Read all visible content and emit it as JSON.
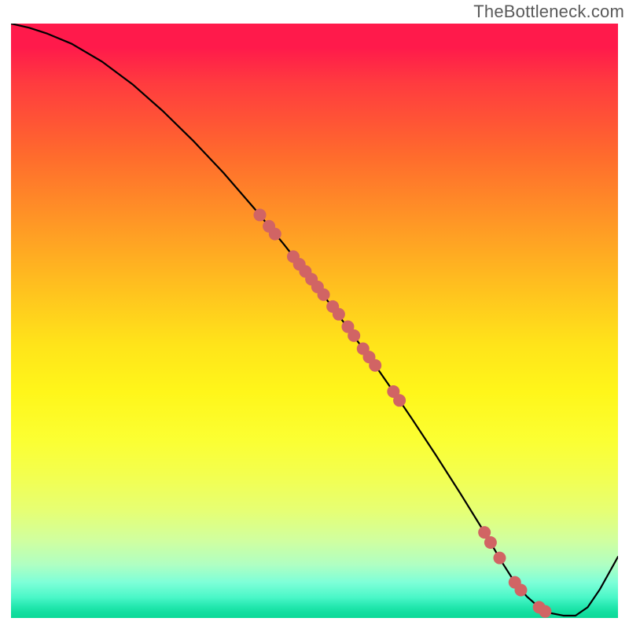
{
  "watermark": "TheBottleneck.com",
  "colors": {
    "curve": "#000000",
    "marker": "#d16464",
    "gradient_top": "#ff1a4b",
    "gradient_bottom": "#0bd997"
  },
  "chart_data": {
    "type": "line",
    "title": "",
    "xlabel": "",
    "ylabel": "",
    "xlim": [
      0,
      100
    ],
    "ylim": [
      0,
      100
    ],
    "curve": {
      "x": [
        0,
        3,
        6,
        10,
        15,
        20,
        25,
        30,
        35,
        40,
        45,
        50,
        55,
        60,
        63,
        66,
        70,
        74,
        78,
        81,
        83,
        85,
        87,
        89,
        91,
        93,
        95,
        97,
        100
      ],
      "y": [
        100,
        99.3,
        98.3,
        96.6,
        93.6,
        89.8,
        85.3,
        80.3,
        74.9,
        69.0,
        62.8,
        56.3,
        49.5,
        42.5,
        38.1,
        33.6,
        27.4,
        21.0,
        14.4,
        9.2,
        6.0,
        3.6,
        1.8,
        0.8,
        0.4,
        0.4,
        1.8,
        4.8,
        10.3
      ]
    },
    "markers": {
      "x": [
        41.0,
        42.5,
        43.5,
        46.5,
        47.5,
        48.5,
        49.5,
        50.5,
        51.5,
        53.0,
        54.0,
        55.5,
        56.5,
        58.0,
        59.0,
        60.0,
        63.0,
        64.0,
        78.0,
        79.0,
        80.5,
        83.0,
        84.0,
        87.0,
        88.0
      ],
      "y": [
        67.8,
        65.9,
        64.6,
        60.8,
        59.5,
        58.3,
        57.0,
        55.7,
        54.4,
        52.4,
        51.1,
        49.0,
        47.5,
        45.3,
        43.9,
        42.5,
        38.1,
        36.6,
        14.4,
        12.7,
        10.1,
        6.0,
        4.7,
        1.8,
        1.1
      ]
    },
    "marker_radius_px": 8
  }
}
